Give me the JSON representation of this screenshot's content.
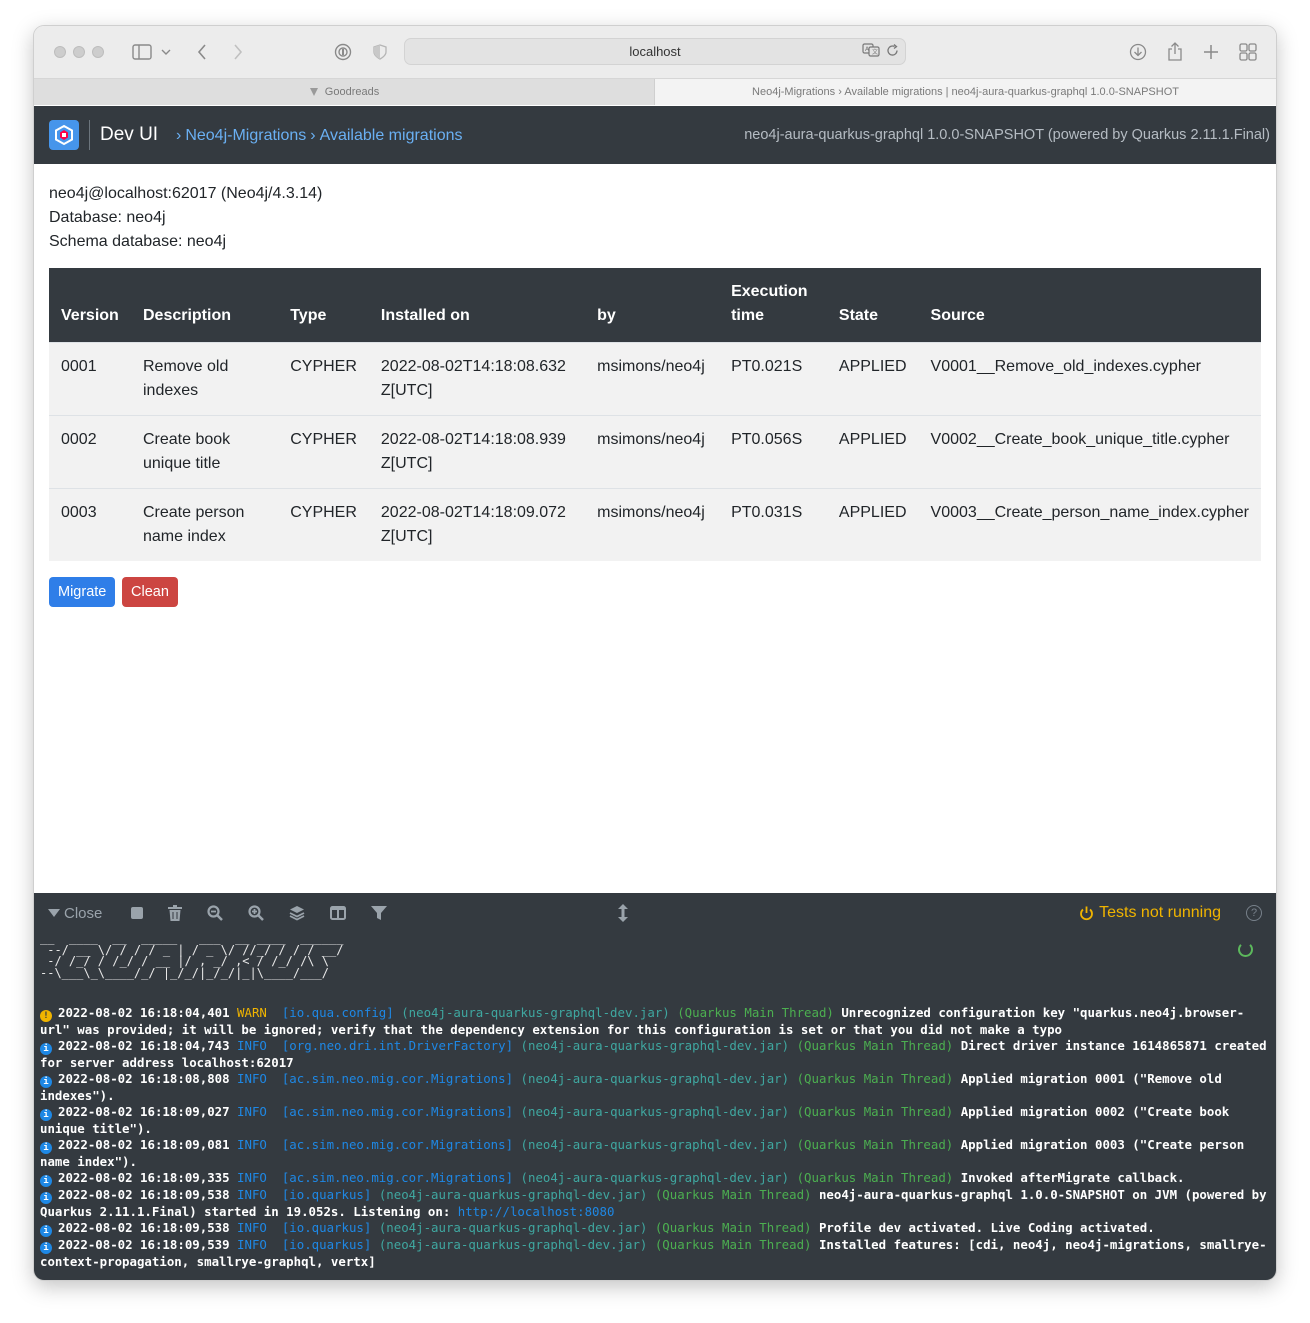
{
  "browser": {
    "url": "localhost",
    "tabs": [
      {
        "title": "Goodreads",
        "active": false
      },
      {
        "title": "Neo4j-Migrations › Available migrations | neo4j-aura-quarkus-graphql 1.0.0-SNAPSHOT",
        "active": true
      }
    ]
  },
  "header": {
    "title": "Dev UI",
    "breadcrumb": [
      "Neo4j-Migrations",
      "Available migrations"
    ],
    "app_version": "neo4j-aura-quarkus-graphql 1.0.0-SNAPSHOT (powered by Quarkus 2.11.1.Final)"
  },
  "connection": {
    "server": "neo4j@localhost:62017 (Neo4j/4.3.14)",
    "database": "Database: neo4j",
    "schema_database": "Schema database: neo4j"
  },
  "table": {
    "headers": {
      "version": "Version",
      "description": "Description",
      "type": "Type",
      "installed_on": "Installed on",
      "by": "by",
      "execution_time": "Execution time",
      "state": "State",
      "source": "Source"
    },
    "rows": [
      {
        "version": "0001",
        "description": "Remove old indexes",
        "type": "CYPHER",
        "installed_on": "2022-08-02T14:18:08.632Z[UTC]",
        "by": "msimons/neo4j",
        "execution_time": "PT0.021S",
        "state": "APPLIED",
        "source": "V0001__Remove_old_indexes.cypher"
      },
      {
        "version": "0002",
        "description": "Create book unique title",
        "type": "CYPHER",
        "installed_on": "2022-08-02T14:18:08.939Z[UTC]",
        "by": "msimons/neo4j",
        "execution_time": "PT0.056S",
        "state": "APPLIED",
        "source": "V0002__Create_book_unique_title.cypher"
      },
      {
        "version": "0003",
        "description": "Create person name index",
        "type": "CYPHER",
        "installed_on": "2022-08-02T14:18:09.072Z[UTC]",
        "by": "msimons/neo4j",
        "execution_time": "PT0.031S",
        "state": "APPLIED",
        "source": "V0003__Create_person_name_index.cypher"
      }
    ]
  },
  "actions": {
    "migrate": "Migrate",
    "clean": "Clean"
  },
  "footer": {
    "close_label": "Close",
    "tests_status": "Tests not running",
    "help": "?",
    "ascii_banner": "__  ____  __  _____   ___  __ ____  ______ \n --/ __ \\/ / / / _ | / _ \\/ //_/ / / / __/ \n -/ /_/ / /_/ / __ |/ , _/ ,< / /_/ /\\ \\   \n--\\___\\_\\____/_/ |_/_/|_/_/|_|\\____/___/   ",
    "logs": [
      {
        "level": "WARN",
        "time": "2022-08-02 16:18:04,401",
        "category": "[io.qua.config]",
        "jar": "(neo4j-aura-quarkus-graphql-dev.jar)",
        "thread": "(Quarkus Main Thread)",
        "message": "Unrecognized configuration key \"quarkus.neo4j.browser-url\" was provided; it will be ignored; verify that the dependency extension for this configuration is set or that you did not make a typo"
      },
      {
        "level": "INFO",
        "time": "2022-08-02 16:18:04,743",
        "category": "[org.neo.dri.int.DriverFactory]",
        "jar": "(neo4j-aura-quarkus-graphql-dev.jar)",
        "thread": "(Quarkus Main Thread)",
        "message": "Direct driver instance 1614865871 created for server address localhost:62017"
      },
      {
        "level": "INFO",
        "time": "2022-08-02 16:18:08,808",
        "category": "[ac.sim.neo.mig.cor.Migrations]",
        "jar": "(neo4j-aura-quarkus-graphql-dev.jar)",
        "thread": "(Quarkus Main Thread)",
        "message": "Applied migration 0001 (\"Remove old indexes\")."
      },
      {
        "level": "INFO",
        "time": "2022-08-02 16:18:09,027",
        "category": "[ac.sim.neo.mig.cor.Migrations]",
        "jar": "(neo4j-aura-quarkus-graphql-dev.jar)",
        "thread": "(Quarkus Main Thread)",
        "message": "Applied migration 0002 (\"Create book unique title\")."
      },
      {
        "level": "INFO",
        "time": "2022-08-02 16:18:09,081",
        "category": "[ac.sim.neo.mig.cor.Migrations]",
        "jar": "(neo4j-aura-quarkus-graphql-dev.jar)",
        "thread": "(Quarkus Main Thread)",
        "message": "Applied migration 0003 (\"Create person name index\")."
      },
      {
        "level": "INFO",
        "time": "2022-08-02 16:18:09,335",
        "category": "[ac.sim.neo.mig.cor.Migrations]",
        "jar": "(neo4j-aura-quarkus-graphql-dev.jar)",
        "thread": "(Quarkus Main Thread)",
        "message": "Invoked afterMigrate callback."
      },
      {
        "level": "INFO",
        "time": "2022-08-02 16:18:09,538",
        "category": "[io.quarkus]",
        "jar": "(neo4j-aura-quarkus-graphql-dev.jar)",
        "thread": "(Quarkus Main Thread)",
        "message": "neo4j-aura-quarkus-graphql 1.0.0-SNAPSHOT on JVM (powered by Quarkus 2.11.1.Final) started in 19.052s. Listening on: ",
        "link": "http://localhost:8080"
      },
      {
        "level": "INFO",
        "time": "2022-08-02 16:18:09,538",
        "category": "[io.quarkus]",
        "jar": "(neo4j-aura-quarkus-graphql-dev.jar)",
        "thread": "(Quarkus Main Thread)",
        "message": "Profile dev activated. Live Coding activated."
      },
      {
        "level": "INFO",
        "time": "2022-08-02 16:18:09,539",
        "category": "[io.quarkus]",
        "jar": "(neo4j-aura-quarkus-graphql-dev.jar)",
        "thread": "(Quarkus Main Thread)",
        "message": "Installed features: [cdi, neo4j, neo4j-migrations, smallrye-context-propagation, smallrye-graphql, vertx]"
      }
    ]
  },
  "colors": {
    "header_bg": "#343a40",
    "link": "#6ab0f3",
    "primary": "#2f7ee8",
    "danger": "#cc4541",
    "warn": "#f0b400",
    "info": "#1e88e5",
    "thread": "#4caf50"
  }
}
